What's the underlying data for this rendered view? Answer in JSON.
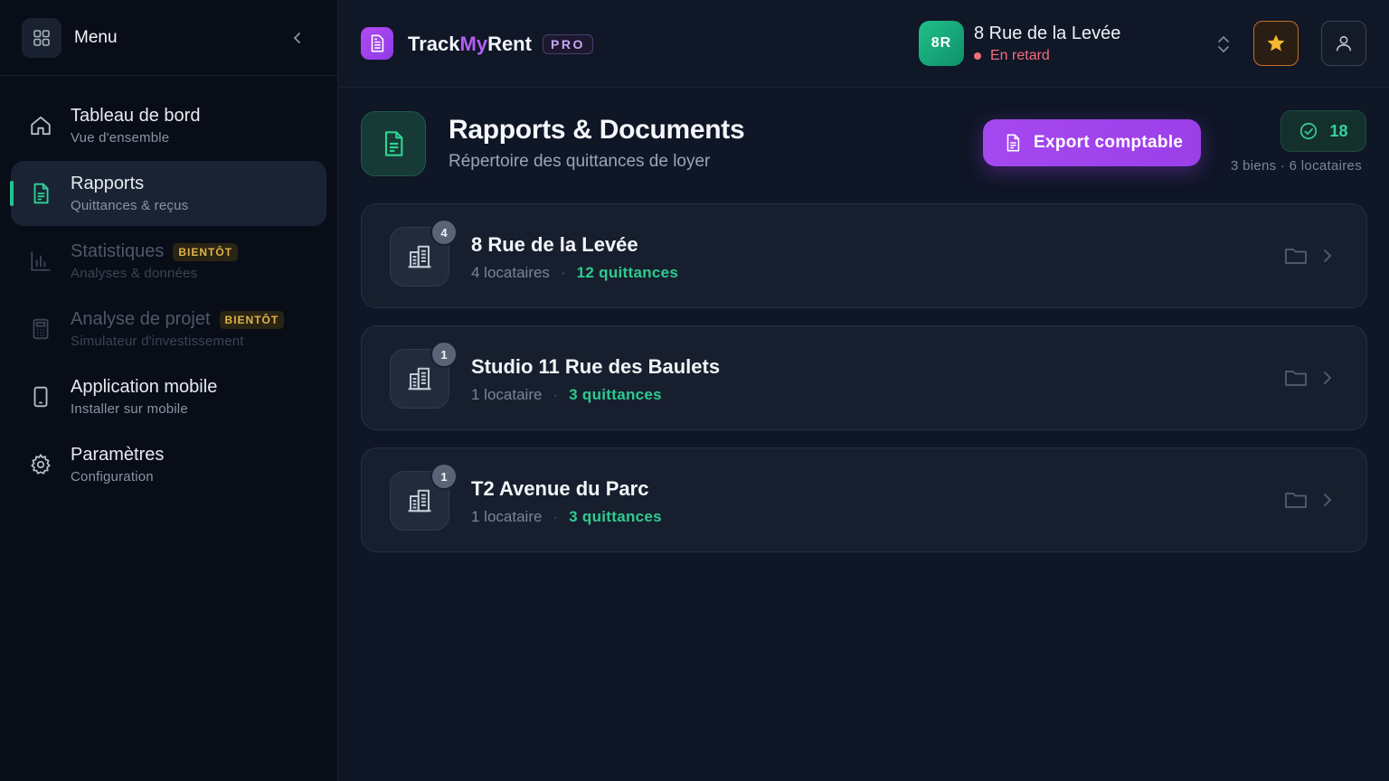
{
  "sidebar": {
    "title": "Menu",
    "items": [
      {
        "label": "Tableau de bord",
        "sub": "Vue d'ensemble",
        "icon": "home-icon"
      },
      {
        "label": "Rapports",
        "sub": "Quittances & reçus",
        "icon": "document-icon"
      },
      {
        "label": "Statistiques",
        "sub": "Analyses & données",
        "icon": "bar-chart-icon",
        "badge": "BIENTÔT"
      },
      {
        "label": "Analyse de projet",
        "sub": "Simulateur d'investissement",
        "icon": "calculator-icon",
        "badge": "BIENTÔT"
      },
      {
        "label": "Application mobile",
        "sub": "Installer sur mobile",
        "icon": "smartphone-icon"
      },
      {
        "label": "Paramètres",
        "sub": "Configuration",
        "icon": "gear-icon"
      }
    ]
  },
  "header": {
    "brand_a": "Track",
    "brand_b": "My",
    "brand_c": "Rent",
    "badge": "PRO",
    "property": {
      "initials": "8R",
      "name": "8 Rue de la Levée",
      "status": "En retard"
    }
  },
  "main": {
    "title": "Rapports & Documents",
    "subtitle": "Répertoire des quittances de loyer",
    "export_label": "Export comptable",
    "total_count": "18",
    "summary": "3 biens · 6 locataires",
    "properties": [
      {
        "name": "8 Rue de la Levée",
        "tenants": "4 locataires",
        "receipts": "12 quittances",
        "count": "4"
      },
      {
        "name": "Studio 11 Rue des Baulets",
        "tenants": "1 locataire",
        "receipts": "3 quittances",
        "count": "1"
      },
      {
        "name": "T2 Avenue du Parc",
        "tenants": "1 locataire",
        "receipts": "3 quittances",
        "count": "1"
      }
    ]
  },
  "colors": {
    "accent_green": "#22c58b",
    "accent_purple": "#a548f0",
    "status_late": "#f26d7d",
    "favorite": "#f5b82e"
  }
}
